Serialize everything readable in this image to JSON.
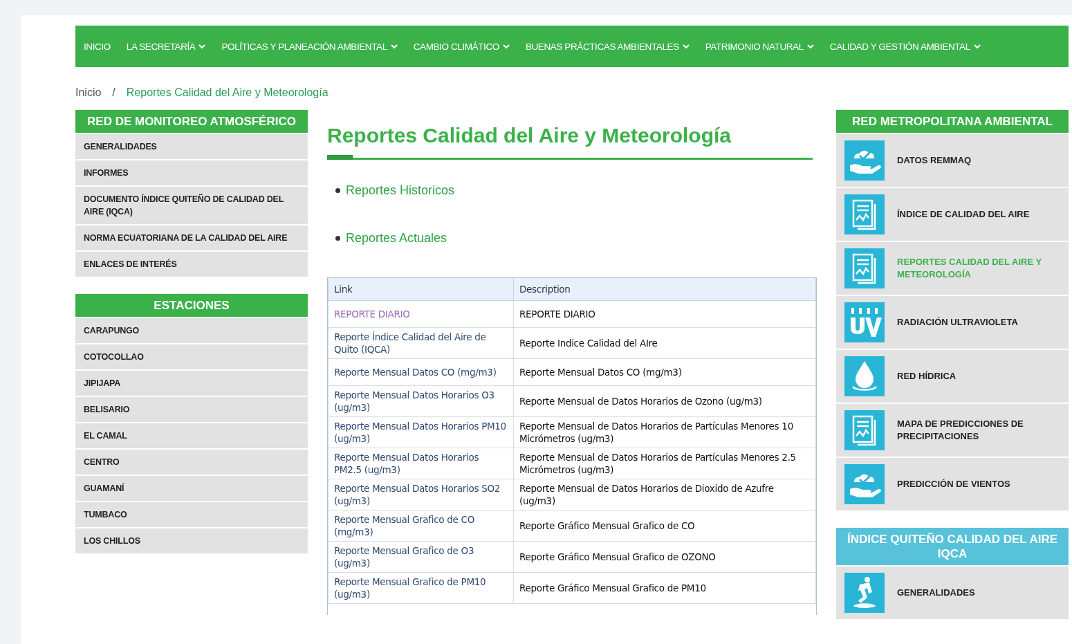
{
  "nav": [
    {
      "label": "INICIO",
      "dropdown": false
    },
    {
      "label": "LA SECRETARÍA",
      "dropdown": true
    },
    {
      "label": "POLÍTICAS Y PLANEACIÓN AMBIENTAL",
      "dropdown": true
    },
    {
      "label": "CAMBIO CLIMÁTICO",
      "dropdown": true
    },
    {
      "label": "BUENAS PRÁCTICAS AMBIENTALES",
      "dropdown": true
    },
    {
      "label": "PATRIMONIO NATURAL",
      "dropdown": true
    },
    {
      "label": "CALIDAD Y GESTIÓN AMBIENTAL",
      "dropdown": true
    }
  ],
  "breadcrumb": {
    "items": [
      {
        "label": "Inicio",
        "current": false
      },
      {
        "label": "Reportes Calidad del Aire y Meteorología",
        "current": true
      }
    ],
    "separator": "/"
  },
  "left_sidebar": [
    {
      "title": "RED DE MONITOREO ATMOSFÉRICO",
      "items": [
        "GENERALIDADES",
        "INFORMES",
        "DOCUMENTO ÍNDICE QUITEÑO DE CALIDAD DEL AIRE (IQCA)",
        "NORMA ECUATORIANA DE LA CALIDAD DEL AIRE",
        "ENLACES DE INTERÉS"
      ]
    },
    {
      "title": "ESTACIONES",
      "items": [
        "CARAPUNGO",
        "COTOCOLLAO",
        "JIPIJAPA",
        "BELISARIO",
        "EL CAMAL",
        "CENTRO",
        "GUAMANÍ",
        "TUMBACO",
        "LOS CHILLOS"
      ]
    }
  ],
  "main": {
    "title": "Reportes Calidad del Aire y Meteorología",
    "links": [
      "Reportes Historicos",
      "Reportes Actuales"
    ],
    "table": {
      "columns": [
        "Link",
        "Description"
      ],
      "rows": [
        {
          "link": "REPORTE DIARIO",
          "visited": true,
          "description": "REPORTE DIARIO"
        },
        {
          "link": "Reporte Índice Calidad del Aire de Quito (IQCA)",
          "visited": false,
          "description": "Reporte Indice Calidad del AIre"
        },
        {
          "link": "Reporte Mensual Datos CO (mg/m3)",
          "visited": false,
          "description": "Reporte Mensual Datos CO (mg/m3)"
        },
        {
          "link": "Reporte Mensual Datos Horarios O3 (ug/m3)",
          "visited": false,
          "description": "Reporte Mensual de Datos Horarios de Ozono (ug/m3)"
        },
        {
          "link": "Reporte Mensual Datos Horarios PM10 (ug/m3)",
          "visited": false,
          "description": "Reporte Mensual de Datos Horarios de Partículas Menores 10 Micrómetros (ug/m3)"
        },
        {
          "link": "Reporte Mensual Datos Horarios PM2.5 (ug/m3)",
          "visited": false,
          "description": "Reporte Mensual de Datos Horarios de Partículas Menores 2.5 Micrómetros (ug/m3)"
        },
        {
          "link": "Reporte Mensual Datos Horarios SO2 (ug/m3)",
          "visited": false,
          "description": "Reporte Mensual de Datos Horarios de Dioxido de Azufre (ug/m3)"
        },
        {
          "link": "Reporte Mensual Grafico de CO (mg/m3)",
          "visited": false,
          "description": "Reporte Gráfico Mensual Grafico de CO"
        },
        {
          "link": "Reporte Mensual Grafico de O3 (ug/m3)",
          "visited": false,
          "description": "Reporte Gráfico Mensual Grafico de OZONO"
        },
        {
          "link": "Reporte Mensual Grafico de PM10 (ug/m3)",
          "visited": false,
          "description": "Reporte Gráfico Mensual Grafico de PM10"
        }
      ]
    }
  },
  "right_sidebar": [
    {
      "title": "RED METROPOLITANA AMBIENTAL",
      "kind": "green",
      "items": [
        {
          "label": "DATOS REMMAQ",
          "kind": "cloud",
          "selected": false
        },
        {
          "label": "ÍNDICE DE CALIDAD DEL AIRE",
          "kind": "document",
          "selected": false
        },
        {
          "label": "REPORTES CALIDAD DEL AIRE Y METEOROLOGÍA",
          "kind": "document",
          "selected": true
        },
        {
          "label": "RADIACIÓN ULTRAVIOLETA",
          "kind": "uv",
          "selected": false
        },
        {
          "label": "RED HÍDRICA",
          "kind": "drop",
          "selected": false
        },
        {
          "label": "MAPA DE PREDICCIONES DE PRECIPITACIONES",
          "kind": "document",
          "selected": false
        },
        {
          "label": "PREDICCIÓN DE VIENTOS",
          "kind": "cloud",
          "selected": false
        }
      ]
    },
    {
      "title": "ÍNDICE QUITEÑO CALIDAD DEL AIRE IQCA",
      "kind": "blue",
      "items": [
        {
          "label": "GENERALIDADES",
          "kind": "figure",
          "selected": false
        }
      ]
    }
  ]
}
